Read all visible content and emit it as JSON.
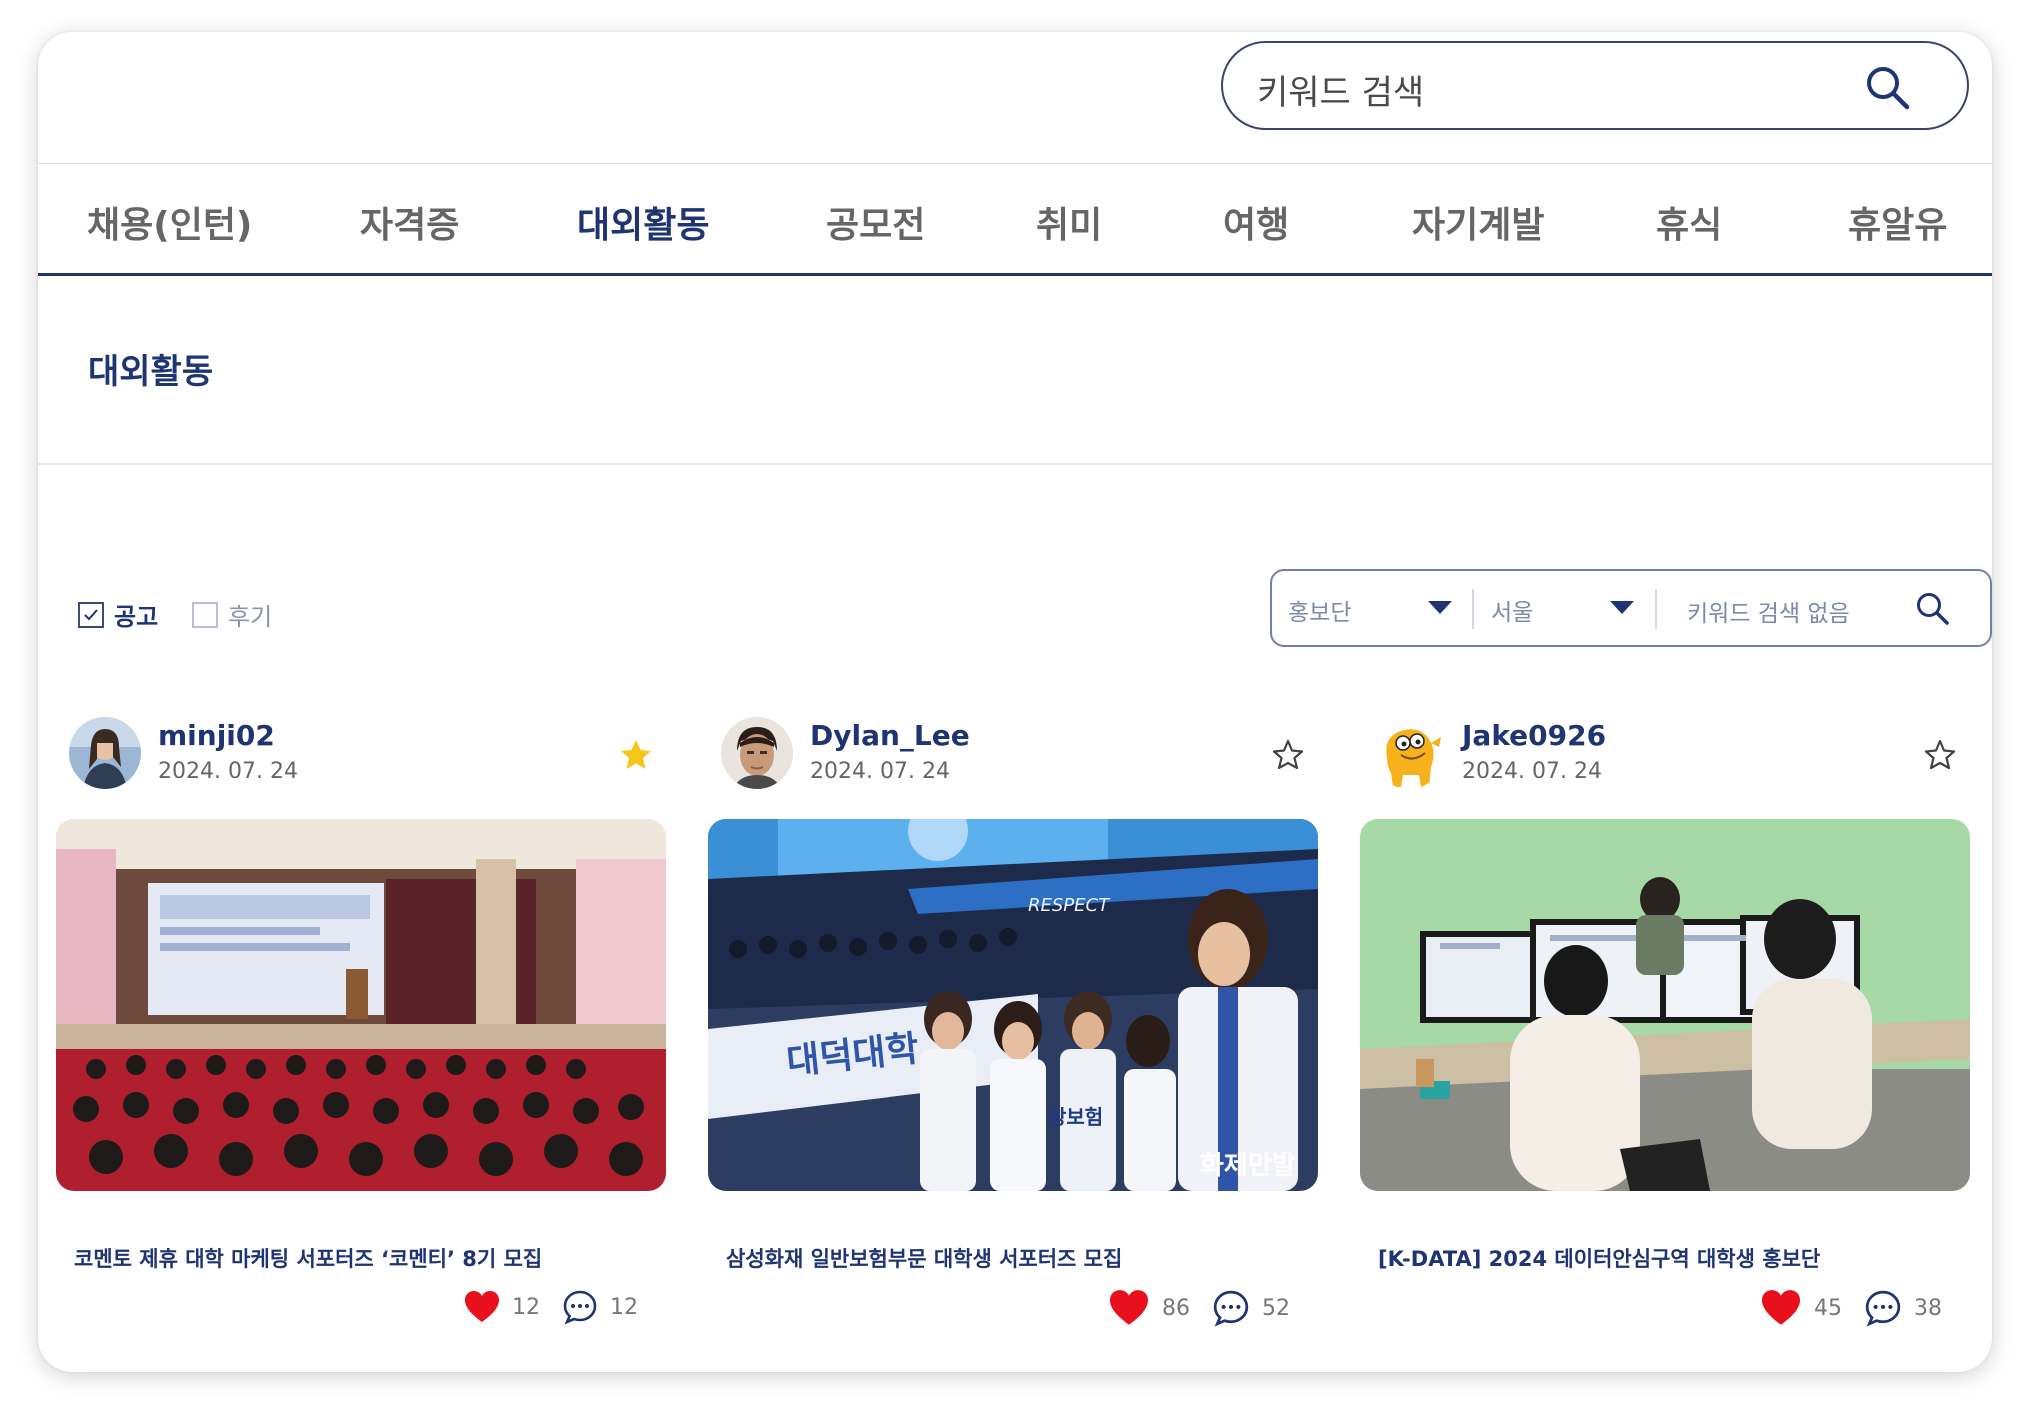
{
  "search": {
    "placeholder": "키워드 검색"
  },
  "tabs": [
    "채용(인턴)",
    "자격증",
    "대외활동",
    "공모전",
    "취미",
    "여행",
    "자기계발",
    "휴식",
    "휴알유"
  ],
  "active_tab": "대외활동",
  "section_title": "대외활동",
  "filters": {
    "checkbox_notice": {
      "label": "공고",
      "checked": true
    },
    "checkbox_review": {
      "label": "후기",
      "checked": false
    },
    "select_category": "홍보단",
    "select_region": "서울",
    "keyword_placeholder": "키워드 검색 없음"
  },
  "cards": [
    {
      "username": "minji02",
      "date": "2024. 07. 24",
      "favorited": true,
      "title": "코멘토 제휴 대학 마케팅 서포터즈 ‘코멘티’ 8기 모집",
      "likes": "12",
      "comments": "12"
    },
    {
      "username": "Dylan_Lee",
      "date": "2024. 07. 24",
      "favorited": false,
      "title": "삼성화재 일반보험부문 대학생 서포터즈 모집",
      "likes": "86",
      "comments": "52"
    },
    {
      "username": "Jake0926",
      "date": "2024. 07. 24",
      "favorited": false,
      "title": "[K-DATA] 2024 데이터안심구역 대학생 홍보단",
      "likes": "45",
      "comments": "38"
    }
  ],
  "photo_text": {
    "card2_banner": "대덕대학",
    "card2_respect": "RESPECT",
    "card2_jersey": "강보험",
    "card2_watermark": "화제만발"
  },
  "colors": {
    "primary": "#1f3472",
    "heart": "#e8101c",
    "star_active": "#f5c518"
  },
  "icons": [
    "search-icon",
    "caret-down-icon",
    "star-icon",
    "heart-icon",
    "comment-icon",
    "check-icon"
  ]
}
